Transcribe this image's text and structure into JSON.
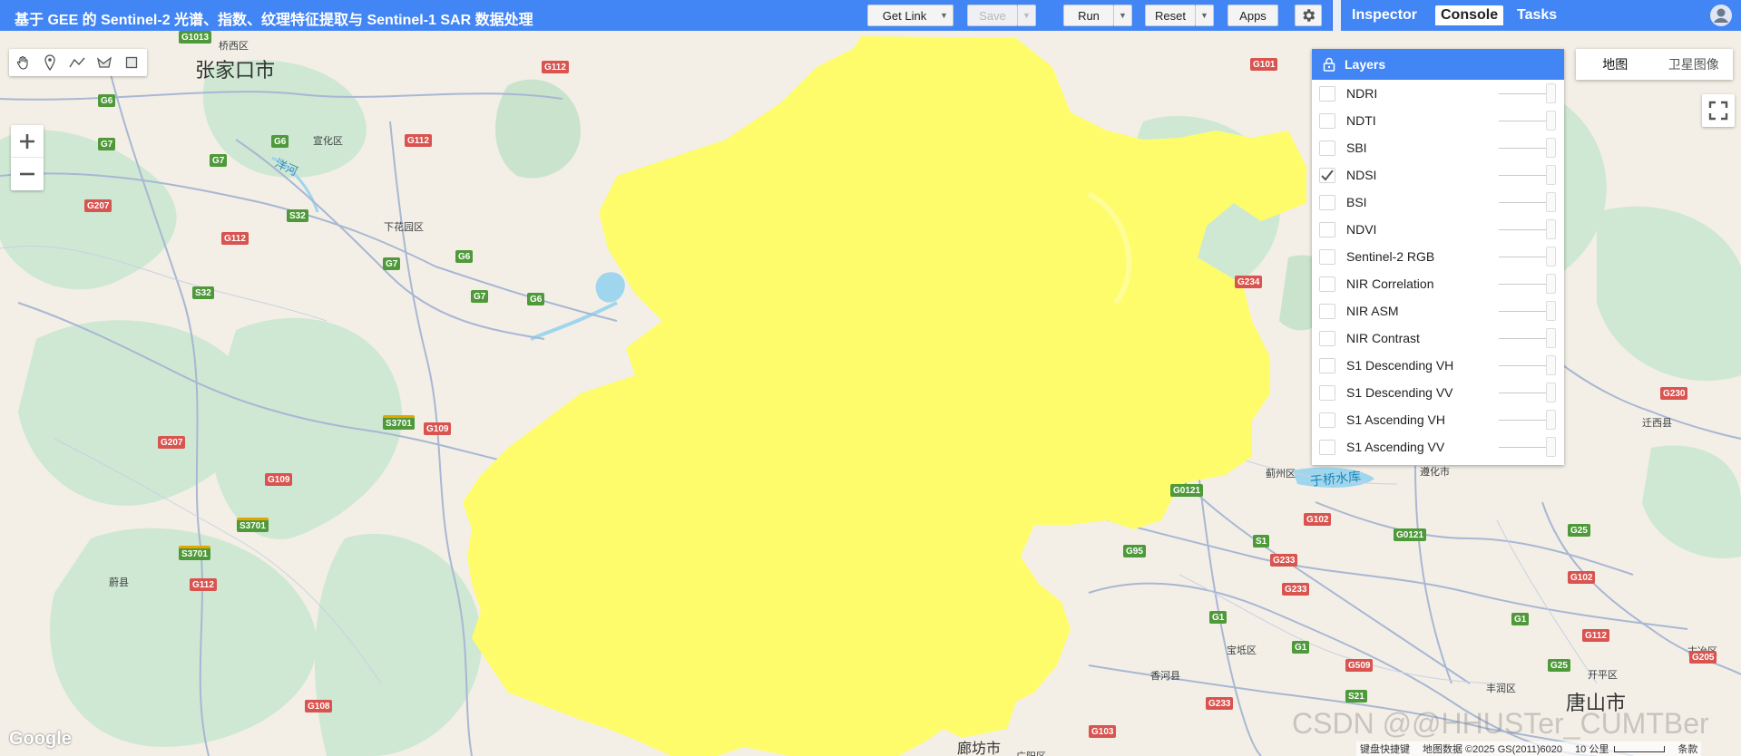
{
  "header": {
    "title": "基于 GEE 的 Sentinel-2 光谱、指数、纹理特征提取与 Sentinel-1 SAR 数据处理",
    "get_link": "Get Link",
    "save": "Save",
    "run": "Run",
    "reset": "Reset",
    "apps": "Apps"
  },
  "right_tabs": [
    "Inspector",
    "Console",
    "Tasks"
  ],
  "active_right_tab": "Console",
  "layers_panel": {
    "title": "Layers",
    "items": [
      {
        "label": "NDRI",
        "checked": false
      },
      {
        "label": "NDTI",
        "checked": false
      },
      {
        "label": "SBI",
        "checked": false
      },
      {
        "label": "NDSI",
        "checked": true
      },
      {
        "label": "BSI",
        "checked": false
      },
      {
        "label": "NDVI",
        "checked": false
      },
      {
        "label": "Sentinel-2 RGB",
        "checked": false
      },
      {
        "label": "NIR Correlation",
        "checked": false
      },
      {
        "label": "NIR ASM",
        "checked": false
      },
      {
        "label": "NIR Contrast",
        "checked": false
      },
      {
        "label": "S1 Descending VH",
        "checked": false
      },
      {
        "label": "S1 Descending VV",
        "checked": false
      },
      {
        "label": "S1 Ascending VH",
        "checked": false
      },
      {
        "label": "S1 Ascending VV",
        "checked": false
      }
    ]
  },
  "map_type": {
    "map": "地图",
    "satellite": "卫星图像"
  },
  "map_labels": {
    "cities": [
      "张家口市",
      "唐山市",
      "廊坊市"
    ],
    "places": [
      "桥西区",
      "宣化区",
      "下花园区",
      "蔚县",
      "洋河",
      "蓟州区",
      "于桥水库",
      "遵化市",
      "迁西县",
      "宝坻区",
      "香河县",
      "丰润区",
      "开平区",
      "古冶区",
      "广阳区"
    ],
    "roads": [
      "G1013",
      "G6",
      "G7",
      "G112",
      "G207",
      "S32",
      "G110",
      "S3701",
      "G109",
      "G108",
      "G101",
      "G234",
      "G0121",
      "G95",
      "S1",
      "G102",
      "G233",
      "G1",
      "G509",
      "S21",
      "G103",
      "G25",
      "G205",
      "G230",
      "G1",
      "S21"
    ]
  },
  "attribution": {
    "shortcuts": "键盘快捷键",
    "data": "地图数据 ©2025 GS(2011)6020",
    "scale": "10 公里",
    "terms": "条款"
  },
  "watermark": "CSDN @@HHUSTer_CUMTBer",
  "google_logo": "Google",
  "colors": {
    "brand": "#4285f4",
    "ndsi_fill": "#fffc6b"
  }
}
